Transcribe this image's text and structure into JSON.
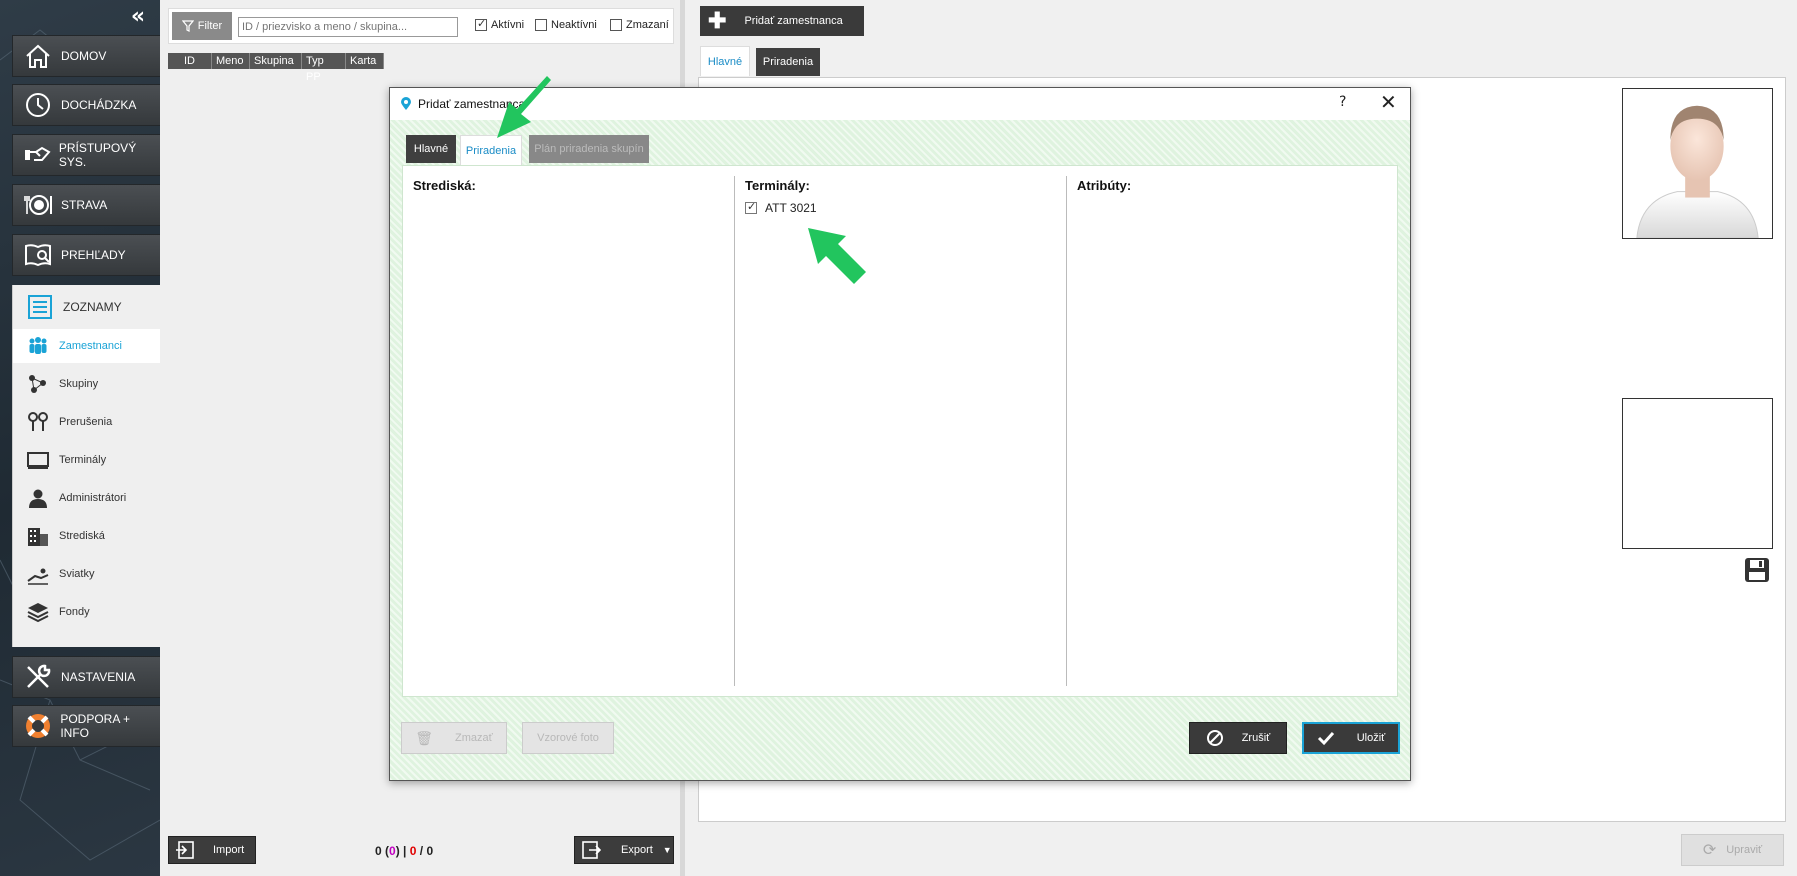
{
  "sidebar": {
    "collapse_icon": "chevrons-left-icon",
    "main_items": [
      {
        "label": "DOMOV",
        "icon": "home-icon"
      },
      {
        "label": "DOCHÁDZKA",
        "icon": "clock-icon"
      },
      {
        "label": "PRÍSTUPOVÝ SYS.",
        "icon": "access-icon"
      },
      {
        "label": "STRAVA",
        "icon": "meal-icon"
      },
      {
        "label": "PREHĽADY",
        "icon": "reports-icon"
      }
    ],
    "section": {
      "label": "ZOZNAMY",
      "icon": "list-icon"
    },
    "sub_items": [
      {
        "label": "Zamestnanci",
        "icon": "employees-icon"
      },
      {
        "label": "Skupiny",
        "icon": "groups-icon"
      },
      {
        "label": "Prerušenia",
        "icon": "interruptions-icon"
      },
      {
        "label": "Terminály",
        "icon": "terminal-icon"
      },
      {
        "label": "Administrátori",
        "icon": "admin-icon"
      },
      {
        "label": "Strediská",
        "icon": "centers-icon"
      },
      {
        "label": "Sviatky",
        "icon": "holidays-icon"
      },
      {
        "label": "Fondy",
        "icon": "funds-icon"
      }
    ],
    "bottom_items": [
      {
        "label": "NASTAVENIA",
        "icon": "tools-icon"
      },
      {
        "label": "PODPORA + INFO",
        "icon": "lifebuoy-icon"
      }
    ]
  },
  "list_panel": {
    "filter_label": "Filter",
    "search_placeholder": "ID / priezvisko a meno / skupina...",
    "checkboxes": [
      {
        "label": "Aktívni",
        "checked": true
      },
      {
        "label": "Neaktívni",
        "checked": false
      },
      {
        "label": "Zmazaní",
        "checked": false
      }
    ],
    "columns": [
      "ID",
      "Meno",
      "Skupina",
      "Typ PP",
      "Karta"
    ],
    "import_label": "Import",
    "export_label": "Export",
    "counts": {
      "a": "0",
      "b": "0",
      "c": "0",
      "d": "0"
    }
  },
  "detail": {
    "add_button": "Pridať zamestnanca",
    "tabs": [
      "Hlavné",
      "Priradenia"
    ],
    "edit_button": "Upraviť"
  },
  "modal": {
    "title": "Pridať zamestnanca",
    "help": "?",
    "close": "✕",
    "tabs": [
      "Hlavné",
      "Priradenia",
      "Plán priradenia skupín"
    ],
    "columns": {
      "centers": "Strediská:",
      "terminals": "Terminály:",
      "attributes": "Atribúty:"
    },
    "terminals": [
      {
        "label": "ATT 3021",
        "checked": true
      }
    ],
    "buttons": {
      "delete": "Zmazať",
      "sample_photo": "Vzorové foto",
      "cancel": "Zrušiť",
      "save": "Uložiť"
    }
  },
  "colors": {
    "accent": "#1aa3d6",
    "arrow": "#22c55e",
    "count_b": "#c000c0",
    "count_c": "#e00000"
  }
}
